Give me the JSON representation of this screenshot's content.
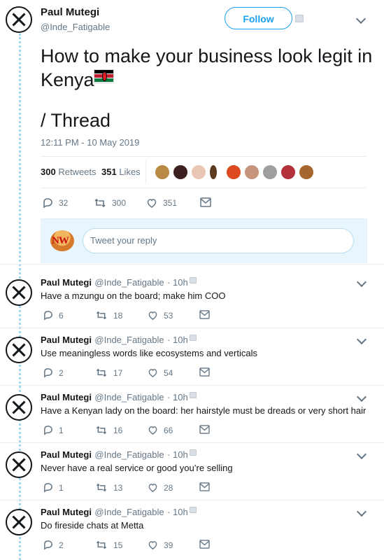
{
  "main_tweet": {
    "name": "Paul Mutegi",
    "handle": "@Inde_Fatigable",
    "follow_label": "Follow",
    "text_line1": "How to make your business look legit in",
    "text_line2": "Kenya",
    "text_line3": "/ Thread",
    "timestamp": "12:11 PM - 10 May 2019",
    "retweets_count": "300",
    "retweets_label": "Retweets",
    "likes_count": "351",
    "likes_label": "Likes",
    "actions": {
      "replies": "32",
      "retweets": "300",
      "likes": "351"
    }
  },
  "reply_box": {
    "placeholder": "Tweet your reply",
    "logo_text": "NW"
  },
  "replies": [
    {
      "name": "Paul Mutegi",
      "handle": "@Inde_Fatigable",
      "time": "· 10h",
      "text": "Have a mzungu on the board; make him COO",
      "replies": "6",
      "retweets": "18",
      "likes": "53"
    },
    {
      "name": "Paul Mutegi",
      "handle": "@Inde_Fatigable",
      "time": "· 10h",
      "text": "Use meaningless words like ecosystems and verticals",
      "replies": "2",
      "retweets": "17",
      "likes": "54"
    },
    {
      "name": "Paul Mutegi",
      "handle": "@Inde_Fatigable",
      "time": "· 10h",
      "text": "Have a Kenyan lady on the board: her hairstyle must be dreads or very short hair",
      "replies": "1",
      "retweets": "16",
      "likes": "66"
    },
    {
      "name": "Paul Mutegi",
      "handle": "@Inde_Fatigable",
      "time": "· 10h",
      "text": "Never have a real service or good you’re selling",
      "replies": "1",
      "retweets": "13",
      "likes": "28"
    },
    {
      "name": "Paul Mutegi",
      "handle": "@Inde_Fatigable",
      "time": "· 10h",
      "text": "Do fireside chats at Metta",
      "replies": "2",
      "retweets": "15",
      "likes": "39"
    }
  ],
  "colors": {
    "accent": "#1da1f2",
    "text": "#14171a",
    "secondary": "#657786",
    "thread_line": "#9fd8f0"
  }
}
